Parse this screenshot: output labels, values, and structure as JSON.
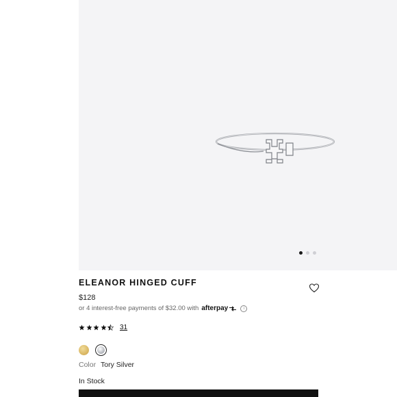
{
  "gallery": {
    "image_alt": "bracelet-image",
    "dots": [
      true,
      false,
      false
    ]
  },
  "product": {
    "title": "ELEANOR HINGED CUFF",
    "price": "$128",
    "installment_text": "or 4 interest-free payments of $32.00 with",
    "afterpay_brand": "afterpay",
    "info_symbol": "i",
    "rating_value": 4.5,
    "review_count": "31",
    "swatches": [
      {
        "name": "gold",
        "color": "#d7b35e"
      },
      {
        "name": "silver",
        "color": "#b9bcc2",
        "selected": true
      }
    ],
    "color_label": "Color",
    "color_value": "Tory Silver",
    "stock_status": "In Stock"
  }
}
